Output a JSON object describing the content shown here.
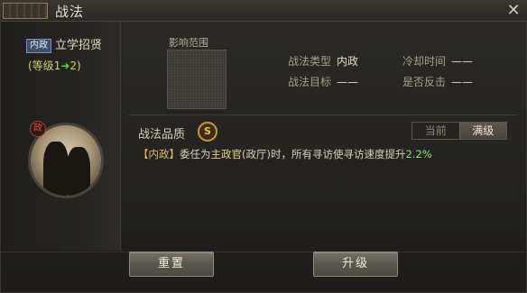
{
  "window": {
    "title": "战法",
    "close_glyph": "✕"
  },
  "tactic": {
    "tag": "内政",
    "name": "立学招贤",
    "level_prefix": "(等级1",
    "level_arrow": "➜",
    "level_suffix": "2)",
    "portrait_badge": "政"
  },
  "range": {
    "label": "影响范围"
  },
  "info": {
    "type_key": "战法类型",
    "type_value": "内政",
    "cooldown_key": "冷却时间",
    "cooldown_value": "——",
    "target_key": "战法目标",
    "target_value": "——",
    "counter_key": "是否反击",
    "counter_value": "——"
  },
  "quality": {
    "label": "战法品质",
    "grade": "S"
  },
  "toggle": {
    "options": [
      "当前",
      "满级"
    ],
    "active_index": 1
  },
  "description": {
    "tag": "【内政】",
    "part1": "委任为",
    "highlight": "主政官",
    "part2": "(政厅)时，所有寻访使寻访速度提升",
    "value": "2.2%"
  },
  "buttons": {
    "reset": "重置",
    "upgrade": "升级"
  },
  "colors": {
    "level_text": "#c9d36c",
    "arrow": "#5fd14a",
    "quality_badge": "#f2c24a",
    "value_green": "#8ee07a"
  }
}
